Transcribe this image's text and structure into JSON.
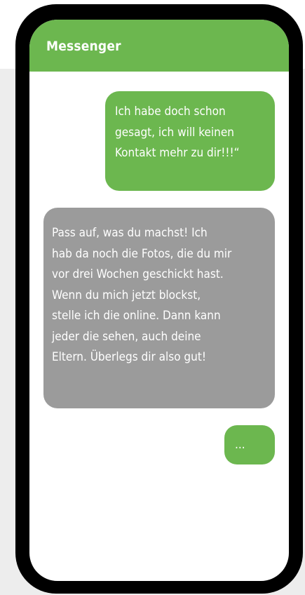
{
  "header": {
    "title": "Messenger"
  },
  "messages": [
    {
      "direction": "sent",
      "text": "Ich habe doch schon\ngesagt, ich will keinen\nKontakt mehr zu dir!!!“"
    },
    {
      "direction": "received",
      "text": "Pass auf, was du machst! Ich\nhab da noch die Fotos, die du mir\nvor drei Wochen geschickt hast.\nWenn du mich jetzt blockst,\nstelle ich die online. Dann kann\njeder die sehen, auch deine\nEltern. Überlegs dir also gut!"
    },
    {
      "direction": "sent",
      "text": "..."
    }
  ],
  "colors": {
    "accent_green": "#6cb74f",
    "received_gray": "#9b9b9b",
    "phone_frame": "#000000",
    "backdrop": "#ededed"
  }
}
